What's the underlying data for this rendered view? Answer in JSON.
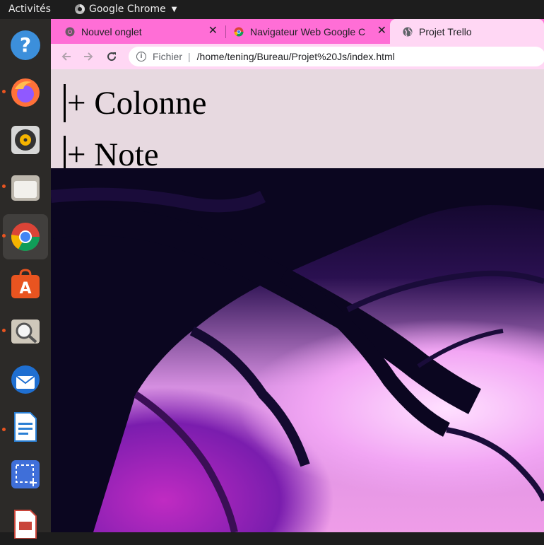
{
  "topbar": {
    "activities": "Activités",
    "app_name": "Google Chrome"
  },
  "dock": {
    "items": [
      {
        "name": "help",
        "icon": "help-icon"
      },
      {
        "name": "firefox",
        "icon": "firefox-icon"
      },
      {
        "name": "rhythmbox",
        "icon": "rhythmbox-icon"
      },
      {
        "name": "files",
        "icon": "files-icon"
      },
      {
        "name": "chrome",
        "icon": "chrome-icon"
      },
      {
        "name": "software",
        "icon": "software-icon"
      },
      {
        "name": "image-viewer",
        "icon": "image-viewer-icon"
      },
      {
        "name": "thunderbird",
        "icon": "thunderbird-icon"
      },
      {
        "name": "writer",
        "icon": "writer-icon"
      },
      {
        "name": "screenshot",
        "icon": "screenshot-icon"
      },
      {
        "name": "impress",
        "icon": "impress-icon"
      }
    ]
  },
  "browser": {
    "tabs": [
      {
        "title": "Nouvel onglet"
      },
      {
        "title": "Navigateur Web Google C"
      },
      {
        "title": "Projet Trello"
      }
    ],
    "address": {
      "scheme": "Fichier",
      "url": "/home/tening/Bureau/Projet%20Js/index.html"
    }
  },
  "page": {
    "add_column": "+ Colonne",
    "add_note": "+ Note"
  },
  "colors": {
    "tab_strip": "#ff6ed6",
    "toolbar": "#ffd7f4",
    "page_header": "#e7d9e0",
    "dock_dot": "#e95420"
  }
}
